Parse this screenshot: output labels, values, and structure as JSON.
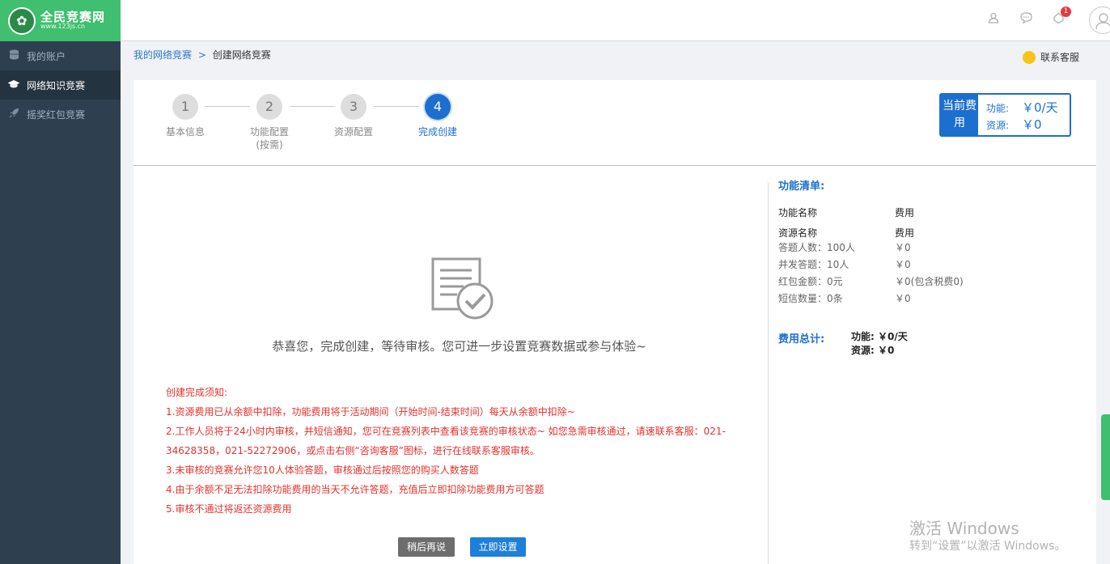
{
  "logo": {
    "name": "全民竞赛网",
    "url": "www.123js.cn"
  },
  "sidebar": {
    "items": [
      {
        "label": "我的账户",
        "icon": "database-icon",
        "active": false
      },
      {
        "label": "网络知识竞赛",
        "icon": "graduation-cap-icon",
        "active": true
      },
      {
        "label": "摇奖红包竞赛",
        "icon": "rocket-icon",
        "active": false
      }
    ]
  },
  "header": {
    "notification_count": "1"
  },
  "breadcrumb": {
    "parent": "我的网络竞赛",
    "separator": ">",
    "current": "创建网络竞赛"
  },
  "contact": {
    "label": "联系客服"
  },
  "steps": [
    {
      "num": "1",
      "label": "基本信息"
    },
    {
      "num": "2",
      "label": "功能配置",
      "sub": "(按需)"
    },
    {
      "num": "3",
      "label": "资源配置"
    },
    {
      "num": "4",
      "label": "完成创建",
      "active": true
    }
  ],
  "current_fee": {
    "title": "当前费用",
    "function_label": "功能:",
    "function_value": "￥0/天",
    "resource_label": "资源:",
    "resource_value": "￥0"
  },
  "main": {
    "congrats": "恭喜您，完成创建，等待审核。您可进一步设置竞赛数据或参与体验~",
    "notes_title": "创建完成须知:",
    "notes": [
      "1.资源费用已从余额中扣除，功能费用将于活动期间（开始时间-结束时间）每天从余额中扣除~",
      "2.工作人员将于24小时内审核，并短信通知，您可在竞赛列表中查看该竞赛的审核状态~ 如您急需审核通过，请速联系客服：021-34628358，021-52272906，或点击右侧“咨询客服”图标，进行在线联系客服审核。",
      "3.未审核的竞赛允许您10人体验答题，审核通过后按照您的购买人数答题",
      "4.由于余额不足无法扣除功能费用的当天不允许答题，充值后立即扣除功能费用方可答题",
      "5.审核不通过将返还资源费用"
    ],
    "later_button": "稍后再说",
    "setup_button": "立即设置"
  },
  "feature_list": {
    "title": "功能清单:",
    "func_header": {
      "name": "功能名称",
      "fee": "费用"
    },
    "res_header": {
      "name": "资源名称",
      "fee": "费用"
    },
    "rows": [
      {
        "name": "答题人数：100人",
        "fee": "￥0"
      },
      {
        "name": "并发答题：10人",
        "fee": "￥0"
      },
      {
        "name": "红包金额：0元",
        "fee": "￥0(包含税费0)"
      },
      {
        "name": "短信数量：0条",
        "fee": "￥0"
      }
    ],
    "total_label": "费用总计:",
    "total_function": "功能: ￥0/天",
    "total_resource": "资源: ￥0"
  },
  "watermark": {
    "line1": "激活 Windows",
    "line2": "转到“设置”以激活 Windows。"
  },
  "colors": {
    "primary": "#1d6fcf",
    "logo_green": "#3fbf6f",
    "sidebar": "#2e3f4f",
    "notice_red": "#e8302c"
  }
}
